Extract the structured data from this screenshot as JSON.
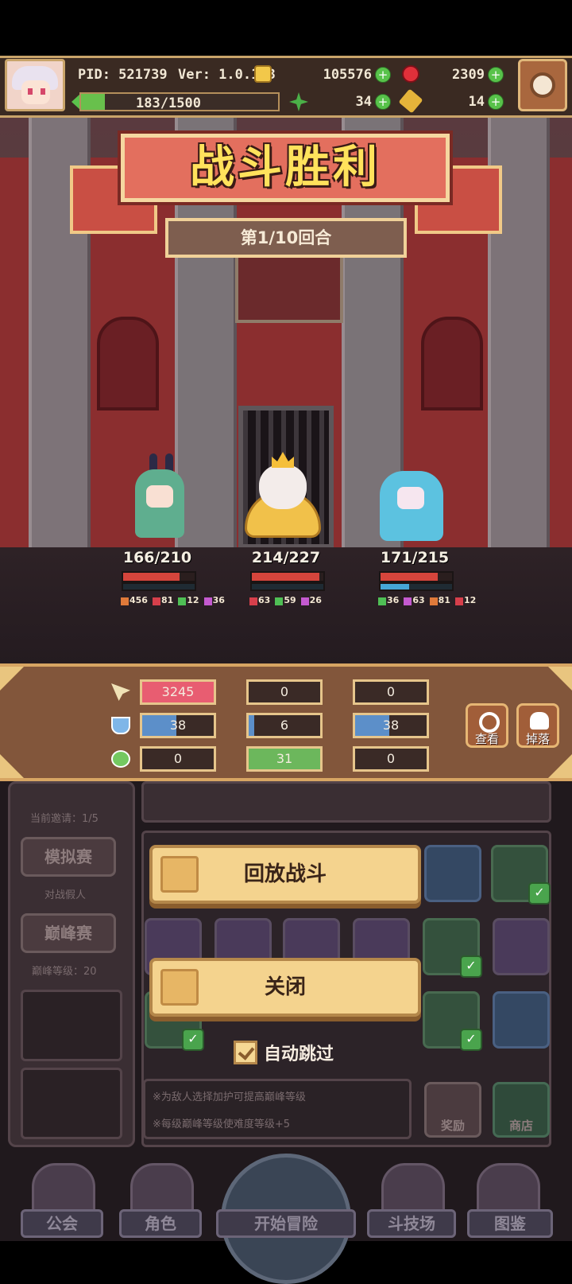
{
  "hud": {
    "pid": "PID: 521739",
    "version": "Ver: 1.0.1.3",
    "gold": "105576",
    "gems": "2309",
    "exp": "183/1500",
    "exp_fraction": 0.122,
    "clover": "34",
    "hammer": "14"
  },
  "battle": {
    "title": "战斗胜利",
    "round": "第1/10回合"
  },
  "characters": [
    {
      "hp": "166/210",
      "hp_frac": 0.79,
      "mp_frac": 0.0,
      "buffs": [
        "456",
        "81",
        "12",
        "36"
      ]
    },
    {
      "hp": "214/227",
      "hp_frac": 0.94,
      "mp_frac": 0.0,
      "buffs": [
        "63",
        "59",
        "26"
      ]
    },
    {
      "hp": "171/215",
      "hp_frac": 0.8,
      "mp_frac": 0.4,
      "buffs": [
        "36",
        "63",
        "81",
        "12"
      ]
    }
  ],
  "stats": {
    "damage": [
      "3245",
      "0",
      "0"
    ],
    "shield": [
      "38",
      "6",
      "38"
    ],
    "heal": [
      "0",
      "31",
      "0"
    ],
    "shield_frac": [
      0.48,
      0.08,
      0.48
    ],
    "view_label": "查看",
    "drop_label": "掉落"
  },
  "dialog": {
    "replay": "回放战斗",
    "close": "关闭",
    "auto_skip": "自动跳过"
  },
  "background": {
    "invite": "当前邀请：1/5",
    "mock_match": "模拟赛",
    "vs_fake": "对战假人",
    "peak_match": "巅峰赛",
    "peak_level": "巅峰等级：20",
    "hint1": "※为敌人选择加护可提高巅峰等级",
    "hint2": "※每级巅峰等级使难度等级+5",
    "reward": "奖励",
    "shop": "商店"
  },
  "nav": {
    "guild": "公会",
    "role": "角色",
    "adventure": "开始冒险",
    "arena": "斗技场",
    "codex": "图鉴"
  }
}
